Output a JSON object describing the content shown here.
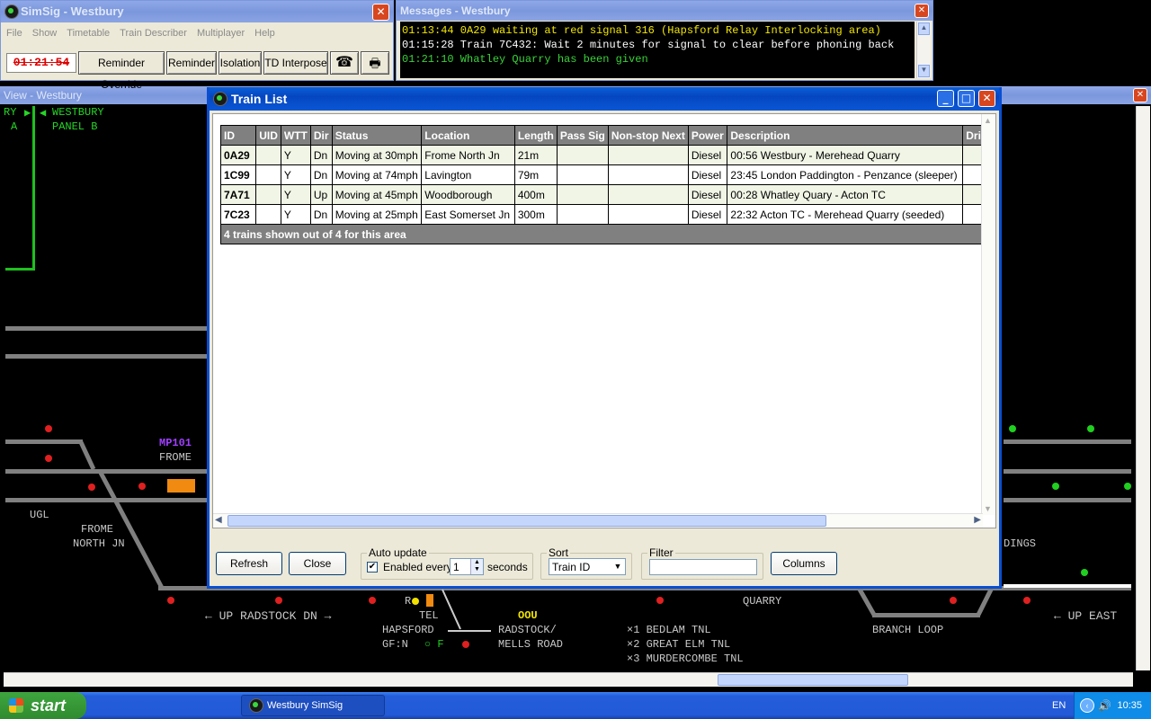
{
  "simsig": {
    "title": "SimSig - Westbury",
    "menu": [
      "File",
      "Show",
      "Timetable",
      "Train Describer",
      "Multiplayer",
      "Help"
    ],
    "clock": "01:21:54",
    "buttons": {
      "reminder_override": "Reminder Override",
      "reminder": "Reminder",
      "isolation": "Isolation",
      "td_interpose": "TD Interpose"
    }
  },
  "messages": {
    "title": "Messages - Westbury",
    "lines": [
      {
        "text": "01:13:44 0A29 waiting at red signal 316 (Hapsford Relay Interlocking area)",
        "color": "#f2e600"
      },
      {
        "text": "01:15:28 Train 7C432: Wait 2 minutes for signal to clear before phoning back",
        "color": "#ffffff"
      },
      {
        "text": "01:21:10 Whatley Quarry has been given",
        "color": "#3ad23a"
      }
    ]
  },
  "view": {
    "title": "View - Westbury",
    "labels": {
      "westbury": "WESTBURY",
      "panel_b": "PANEL B",
      "left_frag_top": "RY",
      "left_frag_a": "A",
      "mp101": "MP101",
      "frome": "FROME",
      "ugl": "UGL",
      "frome_north": "FROME",
      "frome_north_jn": "NORTH JN",
      "up_radstock_dn": "UP RADSTOCK DN",
      "tel": "TEL",
      "oou": "OOU",
      "hapsford": "HAPSFORD",
      "radstock": "RADSTOCK/",
      "mells_road": "MELLS ROAD",
      "gf": "GF:N",
      "gf_f": "F",
      "r_label": "R",
      "bedlam": "×1 BEDLAM TNL",
      "great_elm": "×2 GREAT ELM TNL",
      "murdercombe": "×3 MURDERCOMBE TNL",
      "quarry": "QUARRY",
      "branch_loop": "BRANCH LOOP",
      "up_east": "UP EAST",
      "sidings_frag": "DINGS"
    }
  },
  "trainlist": {
    "title": "Train List",
    "columns": [
      "ID",
      "UID",
      "WTT",
      "Dir",
      "Status",
      "Location",
      "Length",
      "Pass Sig",
      "Non-stop Next",
      "Power",
      "Description",
      "Driv"
    ],
    "rows": [
      [
        "0A29",
        "",
        "Y",
        "Dn",
        "Moving at 30mph",
        "Frome North Jn",
        "21m",
        "",
        "",
        "Diesel",
        "00:56 Westbury - Merehead Quarry",
        ""
      ],
      [
        "1C99",
        "",
        "Y",
        "Dn",
        "Moving at 74mph",
        "Lavington",
        "79m",
        "",
        "",
        "Diesel",
        "23:45 London Paddington - Penzance (sleeper)",
        ""
      ],
      [
        "7A71",
        "",
        "Y",
        "Up",
        "Moving at 45mph",
        "Woodborough",
        "400m",
        "",
        "",
        "Diesel",
        "00:28 Whatley Quary - Acton TC",
        ""
      ],
      [
        "7C23",
        "",
        "Y",
        "Dn",
        "Moving at 25mph",
        "East Somerset Jn",
        "300m",
        "",
        "",
        "Diesel",
        "22:32 Acton TC - Merehead Quarry (seeded)",
        ""
      ]
    ],
    "footer": "4 trains shown out of 4 for this area",
    "refresh": "Refresh",
    "close": "Close",
    "auto_update_label": "Auto update",
    "enabled_every": "Enabled every",
    "interval": "1",
    "seconds": "seconds",
    "sort_label": "Sort",
    "sort_value": "Train ID",
    "filter_label": "Filter",
    "filter_value": "",
    "columns_button": "Columns"
  },
  "taskbar": {
    "start": "start",
    "task": "Westbury SimSig",
    "lang": "EN",
    "time": "10:35"
  }
}
